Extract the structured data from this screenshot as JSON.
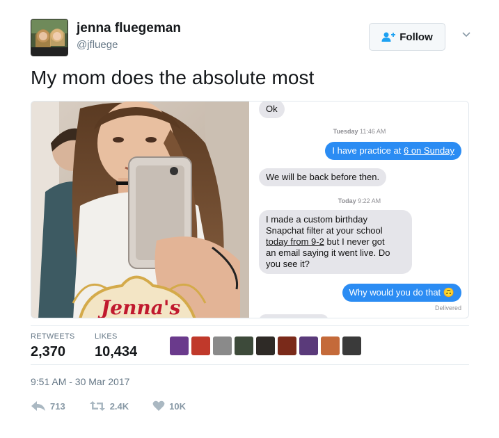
{
  "user": {
    "display_name": "jenna fluegeman",
    "handle": "@jfluege"
  },
  "follow_button": {
    "label": "Follow"
  },
  "tweet": {
    "text": "My mom does the absolute most"
  },
  "media": {
    "photo_caption": "Jenna's",
    "messages": {
      "m1": "Ok",
      "stamp1_day": "Tuesday",
      "stamp1_time": "11:46 AM",
      "m2_pre": "I have practice at ",
      "m2_link": "6 on Sunday",
      "m3": "We will be back before then.",
      "stamp2_day": "Today",
      "stamp2_time": "9:22 AM",
      "m4_line1": "I made a custom birthday",
      "m4_line2": "Snapchat filter at your school",
      "m4_line3_link": "today from 9-2",
      "m4_line3_rest": " but I never got",
      "m4_line4": "an email saying it went live. Do",
      "m4_line5": "you see it?",
      "m5": "Why would you do that",
      "m5_emoji": "🙃",
      "delivered": "Delivered"
    }
  },
  "stats": {
    "retweets_label": "RETWEETS",
    "retweets_value": "2,370",
    "likes_label": "LIKES",
    "likes_value": "10,434"
  },
  "likers": {
    "colors": [
      "#6a3a8c",
      "#c0392b",
      "#8a8a8a",
      "#3d4a3a",
      "#2e2a26",
      "#7a2a1a",
      "#5a3a7a",
      "#c46a3a",
      "#3a3a3a"
    ]
  },
  "timestamp": "9:51 AM - 30 Mar 2017",
  "actions": {
    "reply_count": "713",
    "retweet_count": "2.4K",
    "like_count": "10K"
  },
  "colors": {
    "ios_blue": "#2b8cf3",
    "ios_gray": "#e5e5ea",
    "muted": "#657786"
  }
}
